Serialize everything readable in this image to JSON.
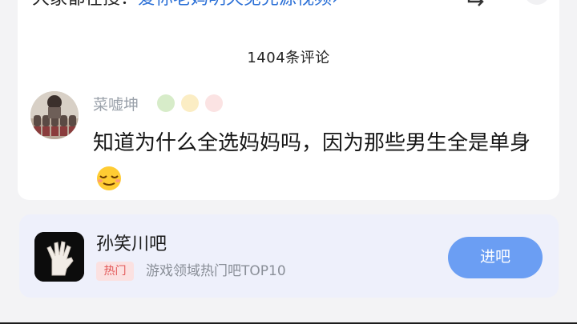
{
  "header": {
    "lead_text": "大家都在搜：",
    "search_link": "爱你老妈明天见完源视频",
    "arrow": "›"
  },
  "comments": {
    "count_label": "1404条评论"
  },
  "comment": {
    "username": "菜嘘坤",
    "text": "知道为什么全选妈妈吗，因为那些男生全是单身",
    "emoji_icon": "relieved-face-icon"
  },
  "forum": {
    "name": "孙笑川吧",
    "tag": "热门",
    "description": "游戏领域热门吧TOP10",
    "join_label": "进吧"
  },
  "colors": {
    "link": "#2a6fd6",
    "username": "#9aa1aa",
    "join_button": "#6b9ef3",
    "hot_tag_bg": "#fbe1e1",
    "hot_tag_text": "#e25555",
    "forum_card_bg": "#eef0fb"
  }
}
